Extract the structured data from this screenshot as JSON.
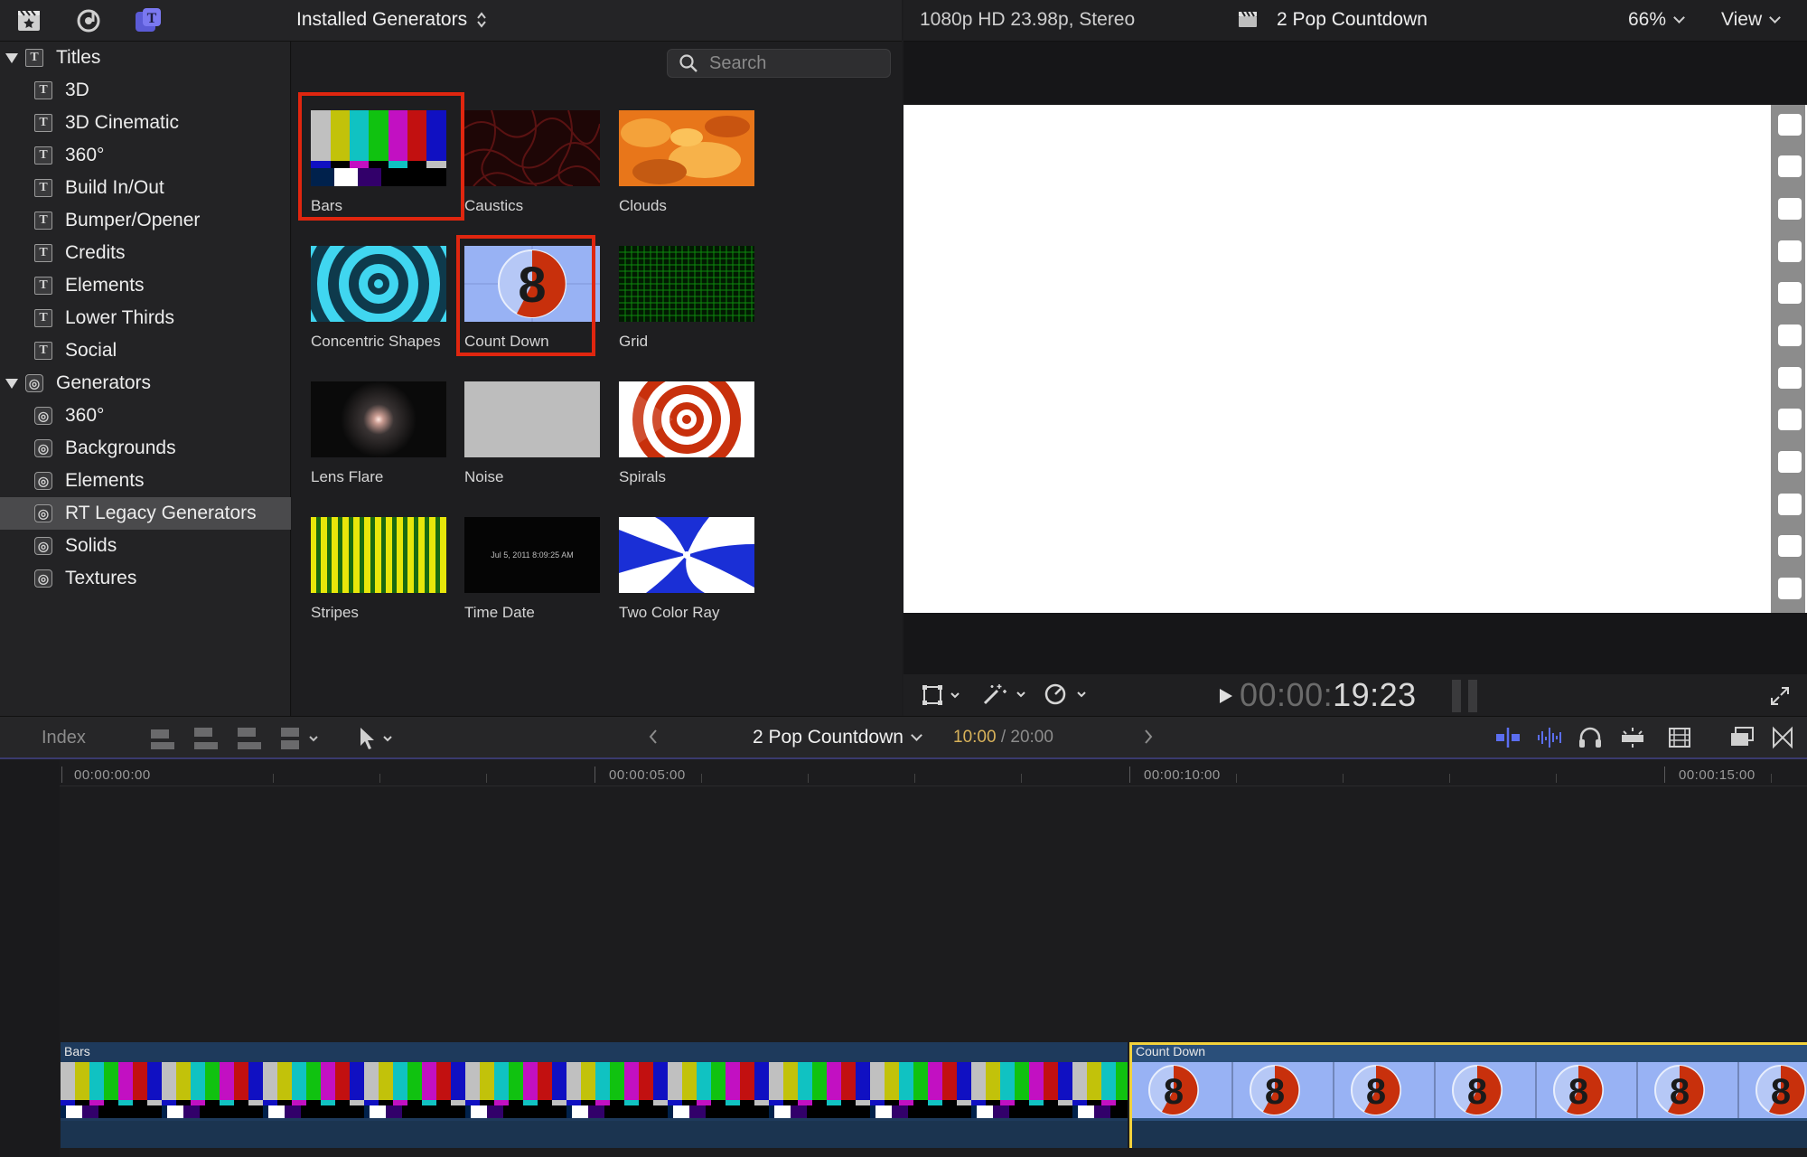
{
  "toolbar": {
    "icons": [
      "libraries-icon",
      "photos-audio-icon",
      "titles-generators-icon"
    ],
    "generator_selector": "Installed Generators"
  },
  "viewer_header": {
    "format": "1080p HD 23.98p, Stereo",
    "title": "2 Pop Countdown",
    "zoom": "66%",
    "view": "View"
  },
  "sidebar": {
    "items": [
      {
        "label": "Titles",
        "type": "title",
        "level": 0
      },
      {
        "label": "3D",
        "type": "title",
        "level": 1
      },
      {
        "label": "3D Cinematic",
        "type": "title",
        "level": 1
      },
      {
        "label": "360°",
        "type": "title",
        "level": 1
      },
      {
        "label": "Build In/Out",
        "type": "title",
        "level": 1
      },
      {
        "label": "Bumper/Opener",
        "type": "title",
        "level": 1
      },
      {
        "label": "Credits",
        "type": "title",
        "level": 1
      },
      {
        "label": "Elements",
        "type": "title",
        "level": 1
      },
      {
        "label": "Lower Thirds",
        "type": "title",
        "level": 1
      },
      {
        "label": "Social",
        "type": "title",
        "level": 1
      },
      {
        "label": "Generators",
        "type": "generator",
        "level": 0
      },
      {
        "label": "360°",
        "type": "generator",
        "level": 1
      },
      {
        "label": "Backgrounds",
        "type": "generator",
        "level": 1
      },
      {
        "label": "Elements",
        "type": "generator",
        "level": 1
      },
      {
        "label": "RT Legacy Generators",
        "type": "generator",
        "level": 1,
        "selected": true
      },
      {
        "label": "Solids",
        "type": "generator",
        "level": 1
      },
      {
        "label": "Textures",
        "type": "generator",
        "level": 1
      }
    ]
  },
  "browser": {
    "search_placeholder": "Search",
    "tiles": [
      {
        "label": "Bars",
        "highlighted": true
      },
      {
        "label": "Caustics"
      },
      {
        "label": "Clouds"
      },
      {
        "label": "Concentric Shapes"
      },
      {
        "label": "Count Down",
        "highlighted": true
      },
      {
        "label": "Grid"
      },
      {
        "label": "Lens Flare"
      },
      {
        "label": "Noise"
      },
      {
        "label": "Spirals"
      },
      {
        "label": "Stripes"
      },
      {
        "label": "Time Date",
        "thumb_text": "Jul 5, 2011 8:09:25 AM"
      },
      {
        "label": "Two Color Ray"
      }
    ]
  },
  "viewer": {
    "timecode_dim": "00:00:",
    "timecode_lit": "19:23"
  },
  "timeline_toolbar": {
    "index": "Index",
    "project_name": "2 Pop Countdown",
    "current_time": "10:00",
    "total_time": "/ 20:00"
  },
  "timeline": {
    "ruler": [
      "00:00:00:00",
      "00:00:05:00",
      "00:00:10:00",
      "00:00:15:00"
    ],
    "clips": [
      {
        "name": "Bars"
      },
      {
        "name": "Count Down",
        "selected": true
      }
    ]
  },
  "colors": {
    "highlight": "#e0260f",
    "selected_clip_border": "#f2d23c",
    "timecode_current": "#d8b25a"
  }
}
